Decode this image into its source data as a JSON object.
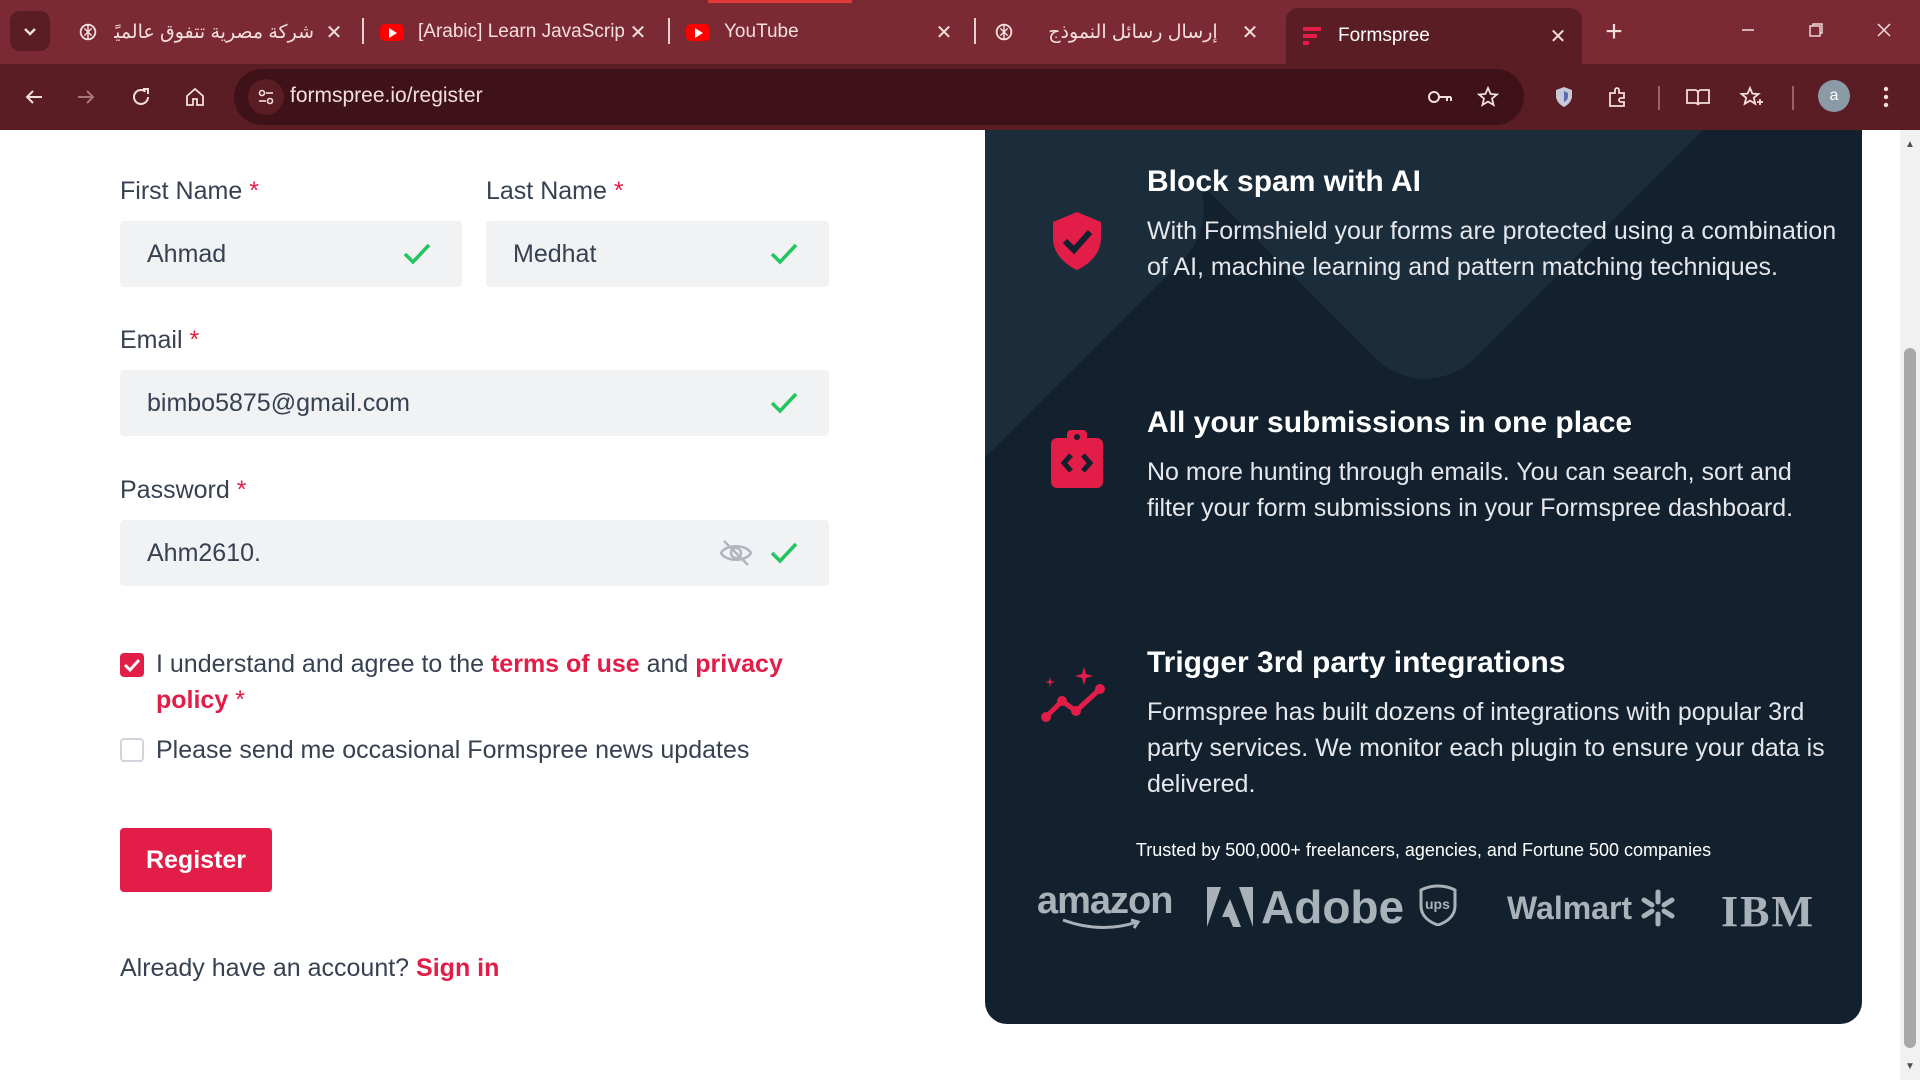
{
  "browser": {
    "tabs": [
      {
        "title": "شركة مصرية تتفوق عالميًا",
        "favicon": "openai-icon"
      },
      {
        "title": "[Arabic] Learn JavaScript",
        "favicon": "youtube-icon"
      },
      {
        "title": "YouTube",
        "favicon": "youtube-icon"
      },
      {
        "title": "إرسال رسائل النموذج",
        "favicon": "openai-icon"
      },
      {
        "title": "Formspree",
        "favicon": "formspree-icon",
        "active": true
      }
    ],
    "url": "formspree.io/register",
    "avatar_letter": "a",
    "colors": {
      "tabstrip": "#7b2a33",
      "toolbar": "#5a1d24",
      "omnibox": "#3e1218"
    }
  },
  "form": {
    "first_name": {
      "label": "First Name",
      "required_mark": "*",
      "value": "Ahmad"
    },
    "last_name": {
      "label": "Last Name",
      "required_mark": "*",
      "value": "Medhat"
    },
    "email": {
      "label": "Email",
      "required_mark": "*",
      "value": "bimbo5875@gmail.com"
    },
    "password": {
      "label": "Password",
      "required_mark": "*",
      "value": "Ahm2610."
    },
    "agree": {
      "checked": true,
      "text_before": "I understand and agree to the",
      "terms_link": "terms of use",
      "text_and": "and",
      "privacy_link_1": "privacy",
      "privacy_link_2": "policy",
      "required_mark": "*"
    },
    "news": {
      "checked": false,
      "text": "Please send me occasional Formspree news updates"
    },
    "register_label": "Register",
    "signin_prompt": "Already have an account?",
    "signin_link": "Sign in"
  },
  "features": [
    {
      "icon": "shield-check-icon",
      "title": "Block spam with AI",
      "desc": "With Formshield your forms are protected using a combination of AI, machine learning and pattern matching techniques."
    },
    {
      "icon": "code-clipboard-icon",
      "title": "All your submissions in one place",
      "desc": "No more hunting through emails. You can search, sort and filter your form submissions in your Formspree dashboard."
    },
    {
      "icon": "sparkle-graph-icon",
      "title": "Trigger 3rd party integrations",
      "desc": "Formspree has built dozens of integrations with popular 3rd party services. We monitor each plugin to ensure your data is delivered."
    }
  ],
  "trusted_text": "Trusted by 500,000+ freelancers, agencies, and Fortune 500 companies",
  "logos": [
    "amazon",
    "Adobe",
    "ups",
    "Walmart",
    "IBM"
  ],
  "colors": {
    "accent": "#e11d48",
    "panel": "#12212d",
    "check": "#22c55e"
  }
}
